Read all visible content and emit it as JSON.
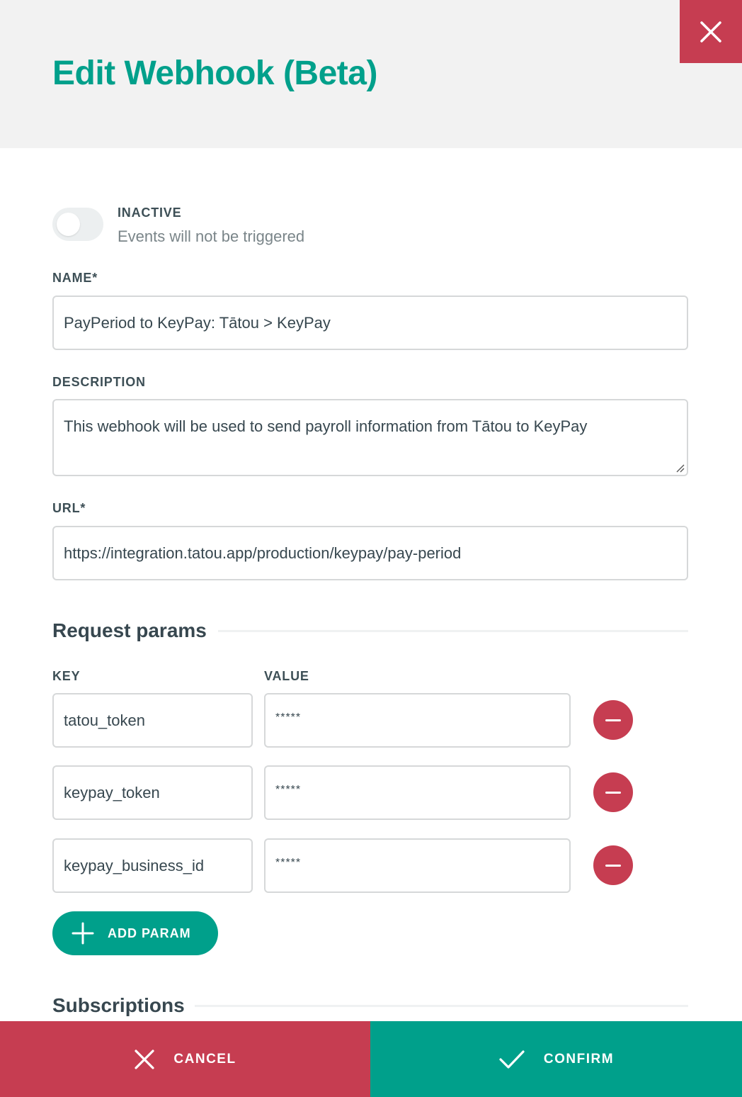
{
  "modal": {
    "title": "Edit Webhook (Beta)",
    "close_icon": "close-icon"
  },
  "status": {
    "active": false,
    "label": "INACTIVE",
    "description": "Events will not be triggered"
  },
  "fields": {
    "name": {
      "label": "NAME*",
      "value": "PayPeriod to KeyPay: Tātou > KeyPay"
    },
    "description": {
      "label": "DESCRIPTION",
      "value": "This webhook will be used to send payroll information from Tātou to KeyPay"
    },
    "url": {
      "label": "URL*",
      "value": "https://integration.tatou.app/production/keypay/pay-period"
    }
  },
  "request_params": {
    "title": "Request params",
    "key_header": "KEY",
    "value_header": "VALUE",
    "rows": [
      {
        "key": "tatou_token",
        "value": "*****"
      },
      {
        "key": "keypay_token",
        "value": "*****"
      },
      {
        "key": "keypay_business_id",
        "value": "*****"
      }
    ],
    "add_label": "ADD PARAM"
  },
  "subscriptions": {
    "title": "Subscriptions"
  },
  "footer": {
    "cancel_label": "CANCEL",
    "confirm_label": "CONFIRM"
  },
  "colors": {
    "brand_teal": "#00a08b",
    "danger_red": "#c63d51",
    "header_bg": "#f2f2f2"
  }
}
